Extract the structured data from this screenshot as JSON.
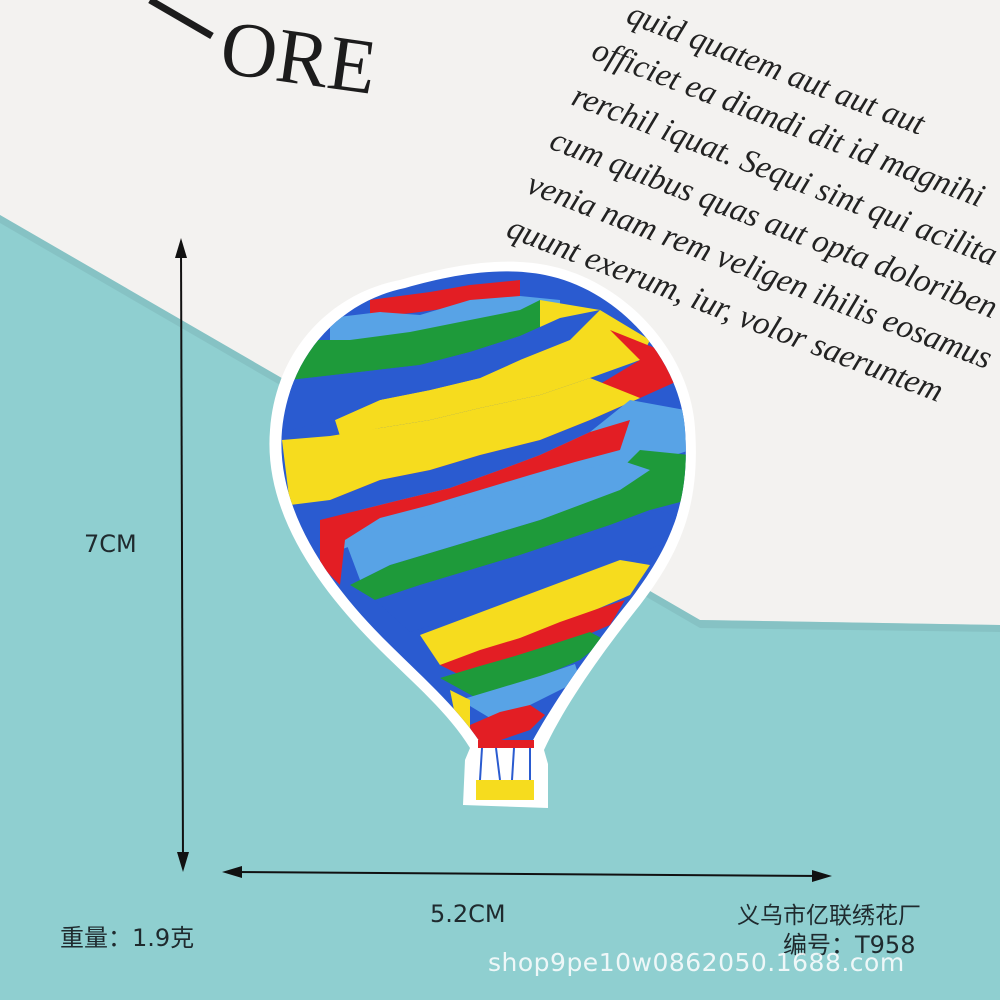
{
  "page": {
    "background_color": "#8fcfd0",
    "paper_color": "#f3f2f0"
  },
  "paper": {
    "heading_fragment": "ORE",
    "lines": [
      "quid quatem aut aut aut",
      "officiet ea diandi dit id magnihi",
      "rerchil iquat. Sequi sint qui acilita",
      "cum quibus quas aut opta doloriben",
      "venia nam rem veligen ihilis eosamus",
      "quunt exerum, iur, volor saeruntem"
    ]
  },
  "patch": {
    "subject": "hot-air-balloon",
    "stripe_colors": [
      "#2a5bd0",
      "#58a3e6",
      "#1e9a3a",
      "#f6dc1e",
      "#e31e24"
    ],
    "border_color": "#ffffff"
  },
  "labels": {
    "height": "7CM",
    "width": "5.2CM",
    "weight": "重量：1.9克",
    "maker": "义乌市亿联绣花厂",
    "code": "编号：T958",
    "shop": "shop9pe10w0862050.1688.com"
  }
}
